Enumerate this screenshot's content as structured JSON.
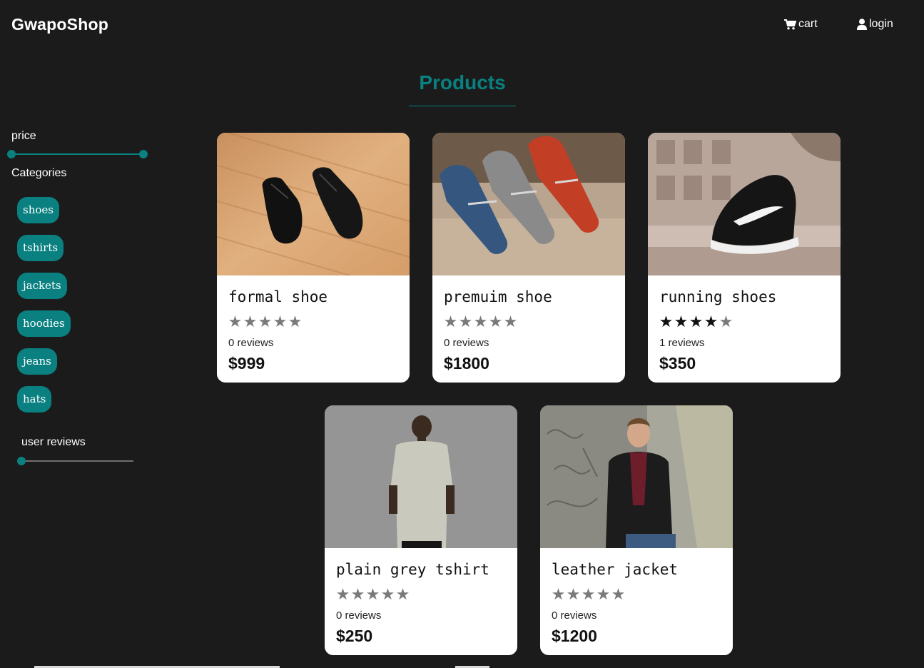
{
  "header": {
    "brand": "GwapoShop",
    "cart_label": "cart",
    "login_label": "login",
    "cart_icon": "cart-icon",
    "login_icon": "user-icon"
  },
  "page": {
    "title": "Products",
    "accent_color": "#0a8080",
    "background_color": "#1b1b1b"
  },
  "filters": {
    "price_label": "price",
    "categories_label": "Categories",
    "categories": [
      "shoes",
      "tshirts",
      "jackets",
      "hoodies",
      "jeans",
      "hats"
    ],
    "user_reviews_label": "user reviews"
  },
  "products": [
    {
      "name": "formal shoe",
      "rating": 0,
      "reviews": "0 reviews",
      "price": "$999"
    },
    {
      "name": "premuim shoe",
      "rating": 0,
      "reviews": "0 reviews",
      "price": "$1800"
    },
    {
      "name": "running shoes",
      "rating": 4,
      "reviews": "1 reviews",
      "price": "$350"
    },
    {
      "name": "plain grey tshirt",
      "rating": 0,
      "reviews": "0 reviews",
      "price": "$250"
    },
    {
      "name": "leather jacket",
      "rating": 0,
      "reviews": "0 reviews",
      "price": "$1200"
    }
  ]
}
